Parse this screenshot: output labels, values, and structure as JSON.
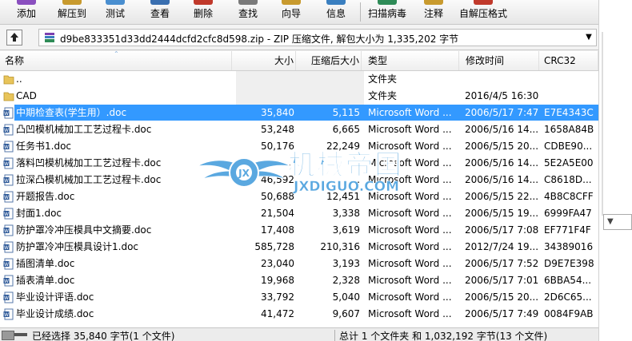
{
  "toolbar": {
    "buttons": [
      {
        "label": "添加",
        "color": "#8a4fbf"
      },
      {
        "label": "解压到",
        "color": "#c89a2e"
      },
      {
        "label": "测试",
        "color": "#4a8fd0"
      },
      {
        "label": "查看",
        "color": "#3a6fb0"
      },
      {
        "label": "删除",
        "color": "#c0392b"
      },
      {
        "label": "查找",
        "color": "#7a7a7a"
      },
      {
        "label": "向导",
        "color": "#c89a2e"
      },
      {
        "label": "信息",
        "color": "#3a7fc0"
      },
      {
        "label": "扫描病毒",
        "color": "#2e8b57"
      },
      {
        "label": "注释",
        "color": "#c89a2e"
      },
      {
        "label": "自解压格式",
        "color": "#c0392b"
      }
    ]
  },
  "address": {
    "text": "d9be833351d33dd2444dcfd2cfc8d598.zip - ZIP 压缩文件, 解包大小为 1,335,202 字节"
  },
  "columns": {
    "name": "名称",
    "size": "大小",
    "packed": "压缩后大小",
    "type": "类型",
    "modified": "修改时间",
    "crc": "CRC32"
  },
  "files": [
    {
      "name": "..",
      "size": "",
      "packed": "",
      "type": "文件夹",
      "modified": "",
      "crc": "",
      "kind": "folder"
    },
    {
      "name": "CAD",
      "size": "",
      "packed": "",
      "type": "文件夹",
      "modified": "2016/4/5 16:30",
      "crc": "",
      "kind": "folder"
    },
    {
      "name": "中期检查表(学生用）.doc",
      "size": "35,840",
      "packed": "5,115",
      "type": "Microsoft Word ...",
      "modified": "2006/5/17 7:47",
      "crc": "E7E4343C",
      "kind": "doc",
      "selected": true
    },
    {
      "name": "凸凹模机械加工工艺过程卡.doc",
      "size": "53,248",
      "packed": "6,665",
      "type": "Microsoft Word ...",
      "modified": "2006/5/16 14...",
      "crc": "1658A84B",
      "kind": "doc"
    },
    {
      "name": "任务书1.doc",
      "size": "50,176",
      "packed": "22,249",
      "type": "Microsoft Word ...",
      "modified": "2006/5/15 20...",
      "crc": "CDBE90...",
      "kind": "doc"
    },
    {
      "name": "落料凹模机械加工工艺过程卡.doc",
      "size": "...",
      "packed": "...",
      "type": "Microsoft Word ...",
      "modified": "2006/5/16 14...",
      "crc": "5E2A5E00",
      "kind": "doc"
    },
    {
      "name": "拉深凸模机械加工工艺过程卡.doc",
      "size": "46,592",
      "packed": "...",
      "type": "Microsoft Word ...",
      "modified": "2006/5/16 14...",
      "crc": "C8618D...",
      "kind": "doc"
    },
    {
      "name": "开题报告.doc",
      "size": "50,688",
      "packed": "12,451",
      "type": "Microsoft Word ...",
      "modified": "2006/5/15 22...",
      "crc": "4B8C8CFF",
      "kind": "doc"
    },
    {
      "name": "封面1.doc",
      "size": "21,504",
      "packed": "3,338",
      "type": "Microsoft Word ...",
      "modified": "2006/5/15 19...",
      "crc": "6999FA47",
      "kind": "doc"
    },
    {
      "name": "防护罩冷冲压模具中文摘要.doc",
      "size": "17,408",
      "packed": "3,619",
      "type": "Microsoft Word ...",
      "modified": "2006/5/17 7:08",
      "crc": "EF771F4F",
      "kind": "doc"
    },
    {
      "name": "防护罩冷冲压模具设计1.doc",
      "size": "585,728",
      "packed": "210,316",
      "type": "Microsoft Word ...",
      "modified": "2012/7/24 19...",
      "crc": "34389016",
      "kind": "doc"
    },
    {
      "name": "插图清单.doc",
      "size": "23,040",
      "packed": "3,193",
      "type": "Microsoft Word ...",
      "modified": "2006/5/17 7:52",
      "crc": "D9E7E398",
      "kind": "doc"
    },
    {
      "name": "插表清单.doc",
      "size": "19,968",
      "packed": "2,328",
      "type": "Microsoft Word ...",
      "modified": "2006/5/17 7:01",
      "crc": "6BBA54...",
      "kind": "doc"
    },
    {
      "name": "毕业设计评语.doc",
      "size": "33,792",
      "packed": "5,040",
      "type": "Microsoft Word ...",
      "modified": "2006/5/15 20...",
      "crc": "2D6C65...",
      "kind": "doc"
    },
    {
      "name": "毕业设计成绩.doc",
      "size": "41,472",
      "packed": "9,607",
      "type": "Microsoft Word ...",
      "modified": "2006/5/17 7:49",
      "crc": "0084F9AB",
      "kind": "doc"
    }
  ],
  "watermark": {
    "title": "机械帝国",
    "url": "JXDIGUO.COM",
    "color": "#5aa8e0"
  },
  "status": {
    "left": "已经选择 35,840 字节(1 个文件)",
    "right": "总计 1 个文件夹 和 1,032,192 字节(13 个文件)"
  }
}
